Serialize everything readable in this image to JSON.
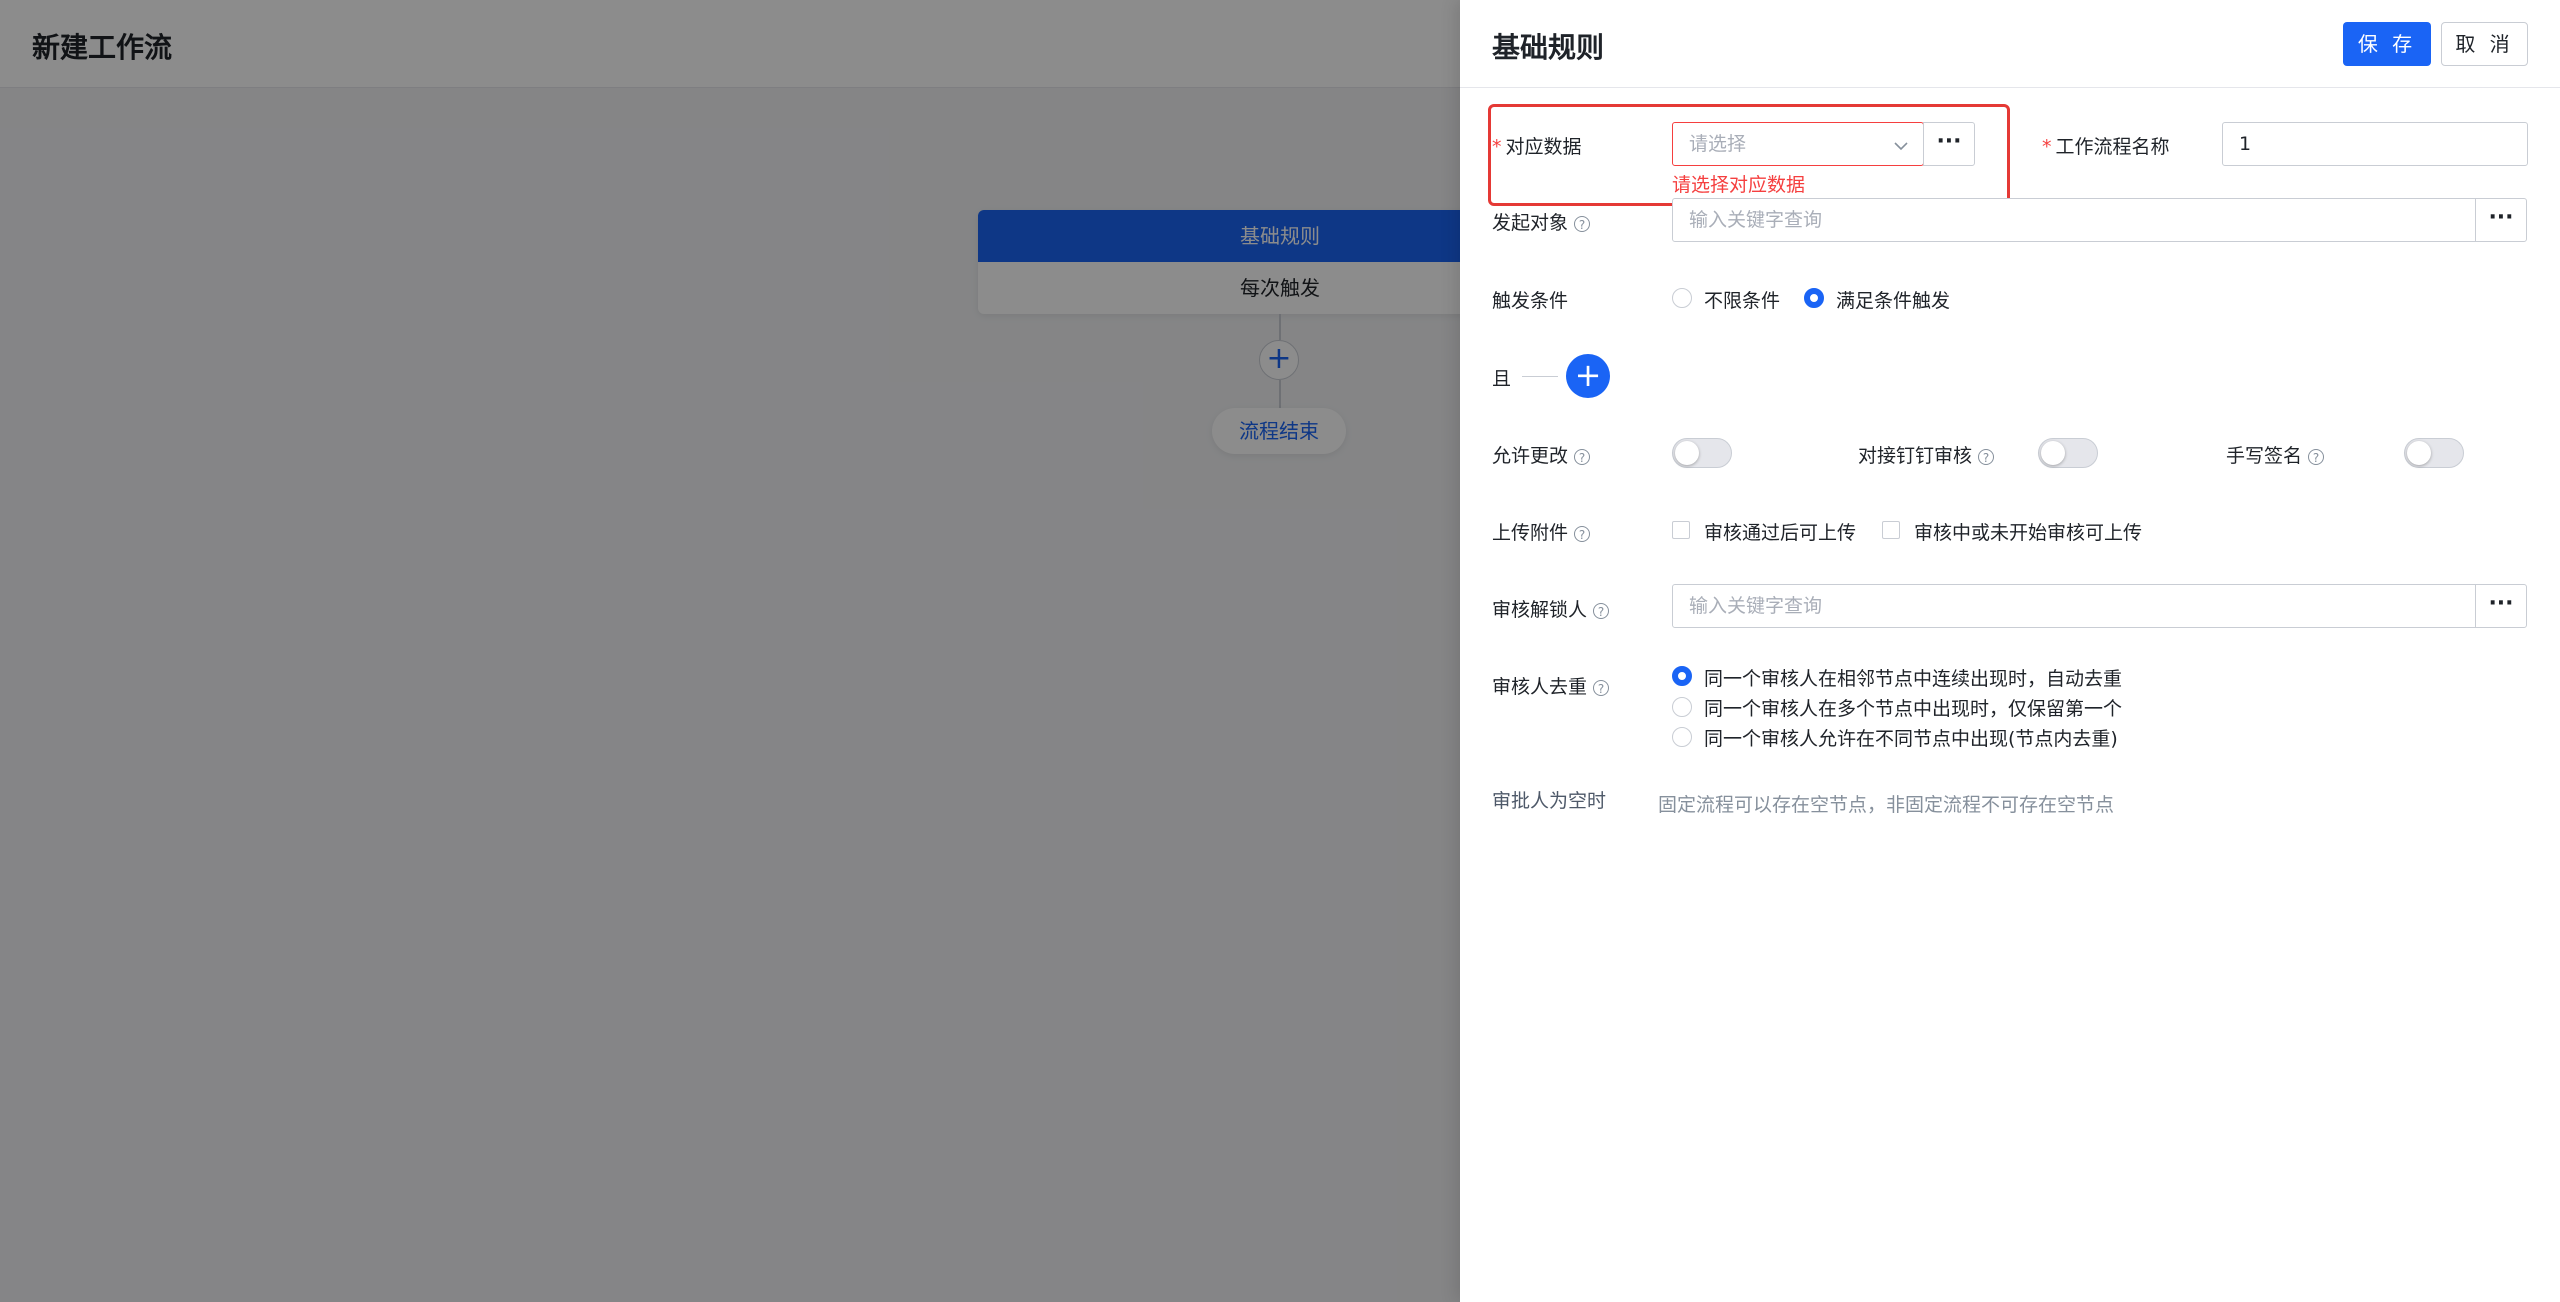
{
  "page": {
    "title": "新建工作流"
  },
  "flow": {
    "node_title": "基础规则",
    "node_body": "每次触发",
    "add_symbol": "+",
    "end_label": "流程结束"
  },
  "drawer": {
    "title": "基础规则",
    "save_label": "保 存",
    "cancel_label": "取 消",
    "required_mark": "*",
    "help_mark": "?",
    "ellipsis": "···",
    "data_source": {
      "label": "对应数据",
      "placeholder": "请选择",
      "error": "请选择对应数据"
    },
    "workflow_name": {
      "label": "工作流程名称",
      "value": "1"
    },
    "initiator": {
      "label": "发起对象",
      "placeholder": "输入关键字查询"
    },
    "trigger": {
      "label": "触发条件",
      "options": [
        "不限条件",
        "满足条件触发"
      ],
      "selected_index": 1
    },
    "and_label": "且",
    "add_condition_symbol": "+",
    "allow_modify": {
      "label": "允许更改",
      "on": false
    },
    "dingtalk_review": {
      "label": "对接钉钉审核",
      "on": false
    },
    "handwritten_sign": {
      "label": "手写签名",
      "on": false
    },
    "upload_attachment": {
      "label": "上传附件",
      "options": [
        "审核通过后可上传",
        "审核中或未开始审核可上传"
      ],
      "checked": [
        false,
        false
      ]
    },
    "unlocker": {
      "label": "审核解锁人",
      "placeholder": "输入关键字查询"
    },
    "dedupe": {
      "label": "审核人去重",
      "options": [
        "同一个审核人在相邻节点中连续出现时，自动去重",
        "同一个审核人在多个节点中出现时，仅保留第一个",
        "同一个审核人允许在不同节点中出现(节点内去重)"
      ],
      "selected_index": 0
    },
    "empty_approver": {
      "label": "审批人为空时",
      "hint": "固定流程可以存在空节点，非固定流程不可存在空节点"
    }
  },
  "colors": {
    "primary": "#1a64f5",
    "error": "#f53f3f",
    "highlight": "#e53935"
  }
}
